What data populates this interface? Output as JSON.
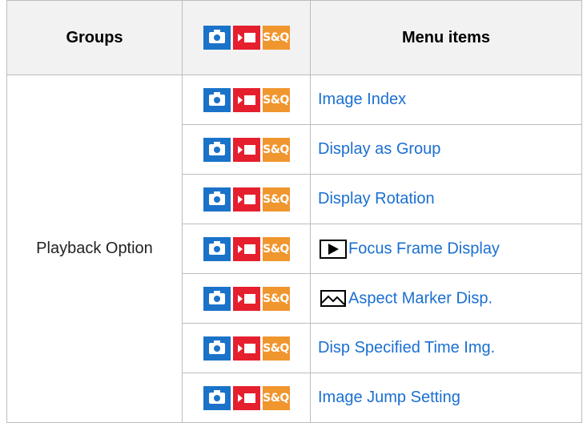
{
  "header": {
    "groups_label": "Groups",
    "menu_items_label": "Menu items",
    "mode_icons": [
      "camera-icon",
      "movie-icon",
      "sq-icon"
    ],
    "sq_text": "S&Q"
  },
  "group": {
    "name": "Playback Option"
  },
  "rows": [
    {
      "label": "Image Index"
    },
    {
      "label": "Display as Group"
    },
    {
      "label": "Display Rotation"
    },
    {
      "label": "Focus Frame Display",
      "prefix_icon": "playback-icon"
    },
    {
      "label": "Aspect Marker Disp.",
      "prefix_icon": "picture-aspect-icon"
    },
    {
      "label": "Disp Specified Time Img."
    },
    {
      "label": "Image Jump Setting"
    }
  ],
  "colors": {
    "photo": "#1a73c9",
    "movie": "#e51f2e",
    "sq": "#f0962e",
    "link": "#1a6fd1",
    "header_bg": "#f2f2f2",
    "border": "#bdbdbd"
  }
}
